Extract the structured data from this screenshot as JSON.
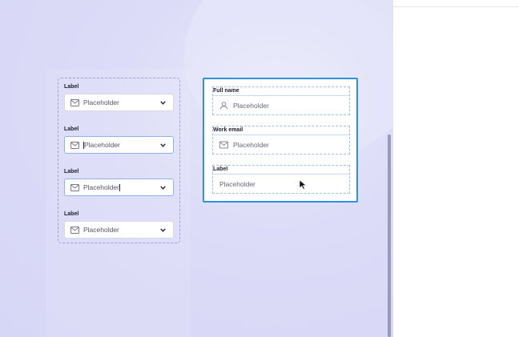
{
  "left_stack": {
    "fields": [
      {
        "label": "Label",
        "placeholder": "Placeholder",
        "icon": "mail-icon",
        "state": "default"
      },
      {
        "label": "Label",
        "placeholder": "Placeholder",
        "icon": "mail-icon",
        "state": "focused-caret-start"
      },
      {
        "label": "Label",
        "placeholder": "Placeholder",
        "icon": "mail-icon",
        "state": "focused-caret-end"
      },
      {
        "label": "Label",
        "placeholder": "Placeholder",
        "icon": "mail-icon",
        "state": "default"
      }
    ]
  },
  "form_card": {
    "fields": [
      {
        "label": "Full name",
        "placeholder": "Placeholder",
        "icon": "user-icon"
      },
      {
        "label": "Work email",
        "placeholder": "Placeholder",
        "icon": "mail-icon"
      },
      {
        "label": "Label",
        "placeholder": "Placeholder",
        "icon": ""
      }
    ]
  },
  "colors": {
    "selection_blue": "#2e90e0",
    "dashed_purple": "#a99ae6",
    "canvas_lavender": "#dcdcf8"
  }
}
